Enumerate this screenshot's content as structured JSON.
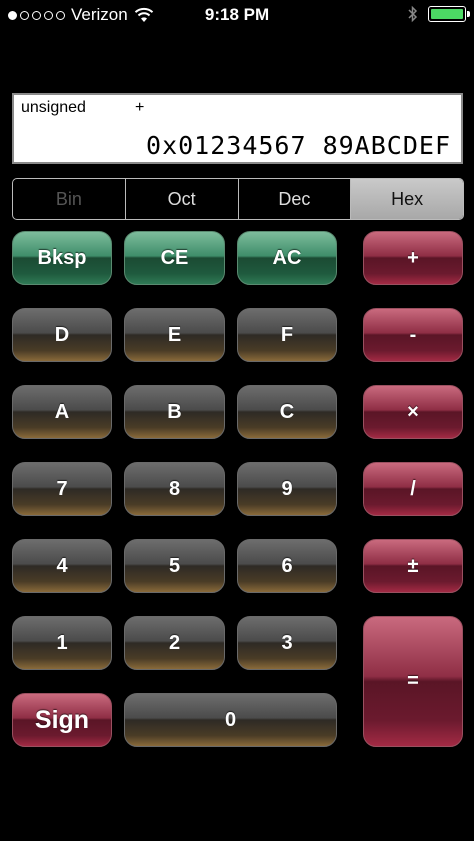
{
  "status_bar": {
    "carrier": "Verizon",
    "time": "9:18 PM",
    "battery_level": 1.0,
    "signal_bars_filled": 1,
    "signal_bars_total": 5
  },
  "display": {
    "mode": "unsigned",
    "operator": "+",
    "value": "0x01234567 89ABCDEF"
  },
  "bases": [
    {
      "label": "Bin",
      "state": "disabled"
    },
    {
      "label": "Oct",
      "state": "normal"
    },
    {
      "label": "Dec",
      "state": "normal"
    },
    {
      "label": "Hex",
      "state": "selected"
    }
  ],
  "keys": {
    "bksp": "Bksp",
    "ce": "CE",
    "ac": "AC",
    "plus": "+",
    "minus": "-",
    "times": "×",
    "divide": "/",
    "plusminus": "±",
    "equals": "=",
    "sign": "Sign",
    "d0": "0",
    "d1": "1",
    "d2": "2",
    "d3": "3",
    "d4": "4",
    "d5": "5",
    "d6": "6",
    "d7": "7",
    "d8": "8",
    "d9": "9",
    "hA": "A",
    "hB": "B",
    "hC": "C",
    "hD": "D",
    "hE": "E",
    "hF": "F"
  },
  "colors": {
    "function_keys": "#2f7a55",
    "operator_keys": "#8f2e45",
    "digit_keys": "#4b4b4b",
    "selected_base": "#b8b8b8",
    "battery": "#4cd964"
  }
}
